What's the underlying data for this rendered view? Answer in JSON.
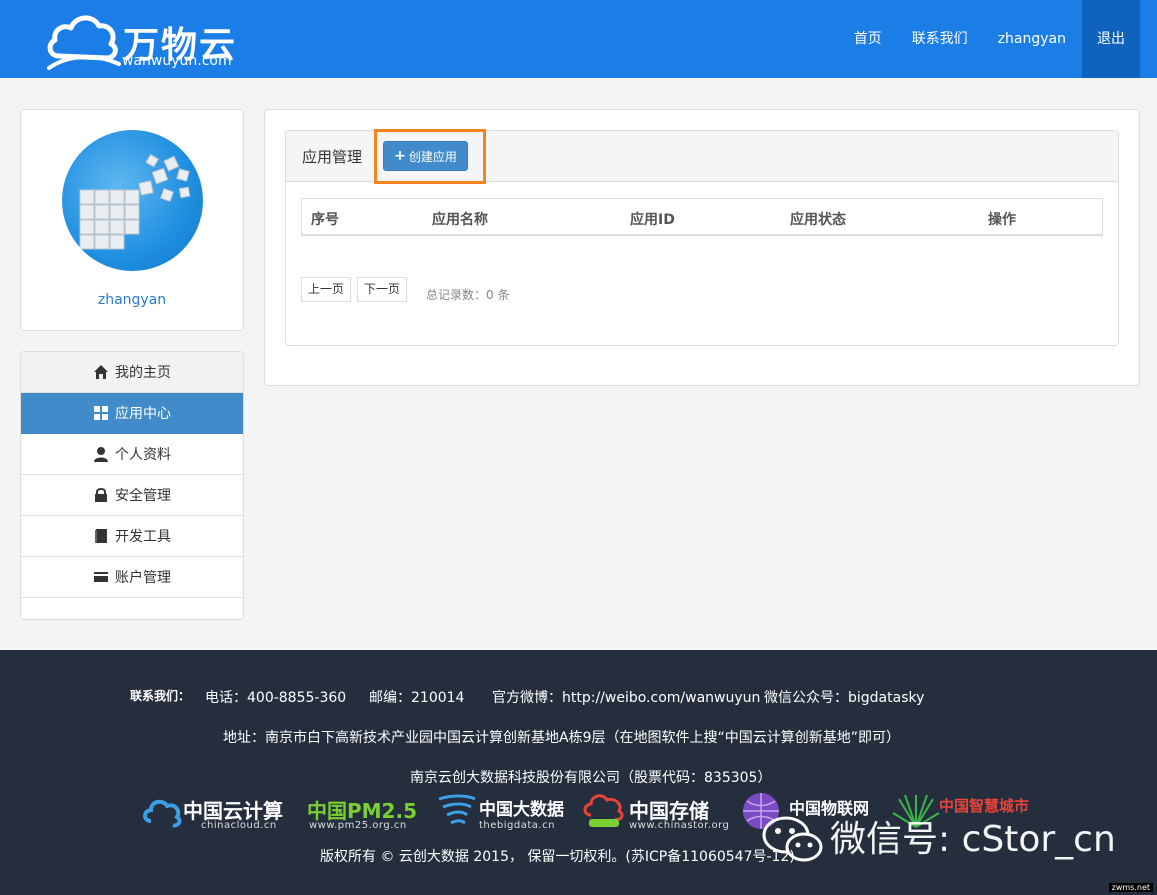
{
  "header": {
    "logo_cn": "万物云",
    "logo_en": "wanwuyun.com",
    "nav": [
      "首页",
      "联系我们",
      "zhangyan"
    ],
    "logout": "退出"
  },
  "profile": {
    "username": "zhangyan"
  },
  "menu": [
    {
      "label": "我的主页",
      "icon": "home-icon"
    },
    {
      "label": "应用中心",
      "icon": "grid-icon"
    },
    {
      "label": "个人资料",
      "icon": "user-icon"
    },
    {
      "label": "安全管理",
      "icon": "lock-icon"
    },
    {
      "label": "开发工具",
      "icon": "book-icon"
    },
    {
      "label": "账户管理",
      "icon": "card-icon"
    }
  ],
  "main": {
    "title": "应用管理",
    "create_label": "创建应用",
    "columns": [
      "序号",
      "应用名称",
      "应用ID",
      "应用状态",
      "操作"
    ],
    "prev": "上一页",
    "next": "下一页",
    "total": "总记录数：0 条"
  },
  "footer": {
    "contact_label": "联系我们：",
    "phone": "电话：400-8855-360",
    "zip": "邮编：210014",
    "weibo": "官方微博：http://weibo.com/wanwuyun",
    "wechat": "微信公众号：bigdatasky",
    "address": "地址：南京市白下高新技术产业园中国云计算创新基地A栋9层（在地图软件上搜“中国云计算创新基地”即可）",
    "company": "南京云创大数据科技股份有限公司（股票代码：835305）",
    "copyright": "版权所有 © 云创大数据 2015， 保留一切权利。(苏ICP备11060547号-12)",
    "logos": [
      {
        "cn": "中国云计算",
        "en": "chinacloud.cn",
        "color": "#ffffff"
      },
      {
        "cn": "中国PM2.5",
        "en": "www.pm25.org.cn",
        "color": "#7ad033"
      },
      {
        "cn": "中国大数据",
        "en": "thebigdata.cn",
        "color": "#ffffff"
      },
      {
        "cn": "中国存储",
        "en": "www.chinastor.org",
        "color": "#ffffff"
      },
      {
        "cn": "中国物联网",
        "en": "",
        "color": "#ffffff"
      },
      {
        "cn": "中国智慧城市",
        "en": "",
        "color": "#e8443a"
      }
    ],
    "watermark": "微信号: cStor_cn",
    "corner": "zwms.net"
  },
  "colors": {
    "brand": "#1a7ee6",
    "primary": "#428bca",
    "highlight": "#f5831f",
    "footer": "#252e3d"
  }
}
